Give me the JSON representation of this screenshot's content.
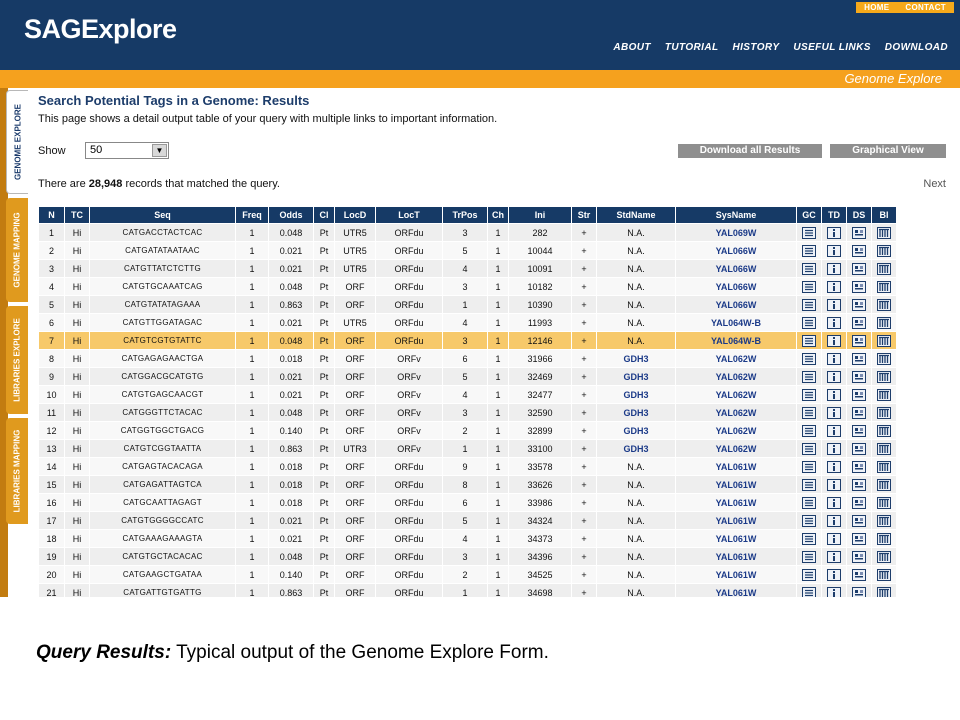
{
  "header": {
    "logo": "SAGExplore",
    "top_links": [
      "HOME",
      "CONTACT"
    ],
    "nav": [
      "ABOUT",
      "TUTORIAL",
      "HISTORY",
      "USEFUL LINKS",
      "DOWNLOAD"
    ],
    "section_title": "Genome Explore"
  },
  "side_tabs": [
    "GENOME EXPLORE",
    "GENOME MAPPING",
    "LIBRARIES EXPLORE",
    "LIBRARIES MAPPING"
  ],
  "page": {
    "title": "Search Potential Tags in a Genome: Results",
    "description": "This page shows a detail output table of your query with multiple links to important information.",
    "show_label": "Show",
    "show_value": "50",
    "download_button": "Download all Results",
    "graphical_button": "Graphical View",
    "records_prefix": "There are ",
    "records_count": "28,948",
    "records_suffix": " records that matched the query.",
    "next_link": "Next"
  },
  "table": {
    "columns": [
      "N",
      "TC",
      "Seq",
      "Freq",
      "Odds",
      "Cl",
      "LocD",
      "LocT",
      "TrPos",
      "Ch",
      "Ini",
      "Str",
      "StdName",
      "SysName",
      "GC",
      "TD",
      "DS",
      "Bl"
    ],
    "highlight_row": 7,
    "rows": [
      [
        "1",
        "Hi",
        "CATGACCTACTCAC",
        "1",
        "0.048",
        "Pt",
        "UTR5",
        "ORFdu",
        "3",
        "1",
        "282",
        "+",
        "N.A.",
        "YAL069W"
      ],
      [
        "2",
        "Hi",
        "CATGATATAATAAC",
        "1",
        "0.021",
        "Pt",
        "UTR5",
        "ORFdu",
        "5",
        "1",
        "10044",
        "+",
        "N.A.",
        "YAL066W"
      ],
      [
        "3",
        "Hi",
        "CATGTTATCTCTTG",
        "1",
        "0.021",
        "Pt",
        "UTR5",
        "ORFdu",
        "4",
        "1",
        "10091",
        "+",
        "N.A.",
        "YAL066W"
      ],
      [
        "4",
        "Hi",
        "CATGTGCAAATCAG",
        "1",
        "0.048",
        "Pt",
        "ORF",
        "ORFdu",
        "3",
        "1",
        "10182",
        "+",
        "N.A.",
        "YAL066W"
      ],
      [
        "5",
        "Hi",
        "CATGTATATAGAAA",
        "1",
        "0.863",
        "Pt",
        "ORF",
        "ORFdu",
        "1",
        "1",
        "10390",
        "+",
        "N.A.",
        "YAL066W"
      ],
      [
        "6",
        "Hi",
        "CATGTTGGATAGAC",
        "1",
        "0.021",
        "Pt",
        "UTR5",
        "ORFdu",
        "4",
        "1",
        "11993",
        "+",
        "N.A.",
        "YAL064W-B"
      ],
      [
        "7",
        "Hi",
        "CATGTCGTGTATTC",
        "1",
        "0.048",
        "Pt",
        "ORF",
        "ORFdu",
        "3",
        "1",
        "12146",
        "+",
        "N.A.",
        "YAL064W-B"
      ],
      [
        "8",
        "Hi",
        "CATGAGAGAACTGA",
        "1",
        "0.018",
        "Pt",
        "ORF",
        "ORFv",
        "6",
        "1",
        "31966",
        "+",
        "GDH3",
        "YAL062W"
      ],
      [
        "9",
        "Hi",
        "CATGGACGCATGTG",
        "1",
        "0.021",
        "Pt",
        "ORF",
        "ORFv",
        "5",
        "1",
        "32469",
        "+",
        "GDH3",
        "YAL062W"
      ],
      [
        "10",
        "Hi",
        "CATGTGAGCAACGT",
        "1",
        "0.021",
        "Pt",
        "ORF",
        "ORFv",
        "4",
        "1",
        "32477",
        "+",
        "GDH3",
        "YAL062W"
      ],
      [
        "11",
        "Hi",
        "CATGGGTTCTACAC",
        "1",
        "0.048",
        "Pt",
        "ORF",
        "ORFv",
        "3",
        "1",
        "32590",
        "+",
        "GDH3",
        "YAL062W"
      ],
      [
        "12",
        "Hi",
        "CATGGTGGCTGACG",
        "1",
        "0.140",
        "Pt",
        "ORF",
        "ORFv",
        "2",
        "1",
        "32899",
        "+",
        "GDH3",
        "YAL062W"
      ],
      [
        "13",
        "Hi",
        "CATGTCGGTAATTA",
        "1",
        "0.863",
        "Pt",
        "UTR3",
        "ORFv",
        "1",
        "1",
        "33100",
        "+",
        "GDH3",
        "YAL062W"
      ],
      [
        "14",
        "Hi",
        "CATGAGTACACAGA",
        "1",
        "0.018",
        "Pt",
        "ORF",
        "ORFdu",
        "9",
        "1",
        "33578",
        "+",
        "N.A.",
        "YAL061W"
      ],
      [
        "15",
        "Hi",
        "CATGAGATTAGTCA",
        "1",
        "0.018",
        "Pt",
        "ORF",
        "ORFdu",
        "8",
        "1",
        "33626",
        "+",
        "N.A.",
        "YAL061W"
      ],
      [
        "16",
        "Hi",
        "CATGCAATTAGAGT",
        "1",
        "0.018",
        "Pt",
        "ORF",
        "ORFdu",
        "6",
        "1",
        "33986",
        "+",
        "N.A.",
        "YAL061W"
      ],
      [
        "17",
        "Hi",
        "CATGTGGGGCCATC",
        "1",
        "0.021",
        "Pt",
        "ORF",
        "ORFdu",
        "5",
        "1",
        "34324",
        "+",
        "N.A.",
        "YAL061W"
      ],
      [
        "18",
        "Hi",
        "CATGAAAGAAAGTA",
        "1",
        "0.021",
        "Pt",
        "ORF",
        "ORFdu",
        "4",
        "1",
        "34373",
        "+",
        "N.A.",
        "YAL061W"
      ],
      [
        "19",
        "Hi",
        "CATGTGCTACACAC",
        "1",
        "0.048",
        "Pt",
        "ORF",
        "ORFdu",
        "3",
        "1",
        "34396",
        "+",
        "N.A.",
        "YAL061W"
      ],
      [
        "20",
        "Hi",
        "CATGAAGCTGATAA",
        "1",
        "0.140",
        "Pt",
        "ORF",
        "ORFdu",
        "2",
        "1",
        "34525",
        "+",
        "N.A.",
        "YAL061W"
      ],
      [
        "21",
        "Hi",
        "CATGATTGTGATTG",
        "1",
        "0.863",
        "Pt",
        "ORF",
        "ORFdu",
        "1",
        "1",
        "34698",
        "+",
        "N.A.",
        "YAL061W"
      ]
    ]
  },
  "caption": {
    "lead": "Query Results:",
    "text": " Typical output of the Genome Explore Form."
  },
  "colors": {
    "navy": "#163a66",
    "orange": "#f5a11e",
    "highlight": "#f7c96a",
    "link": "#1b3a88"
  }
}
